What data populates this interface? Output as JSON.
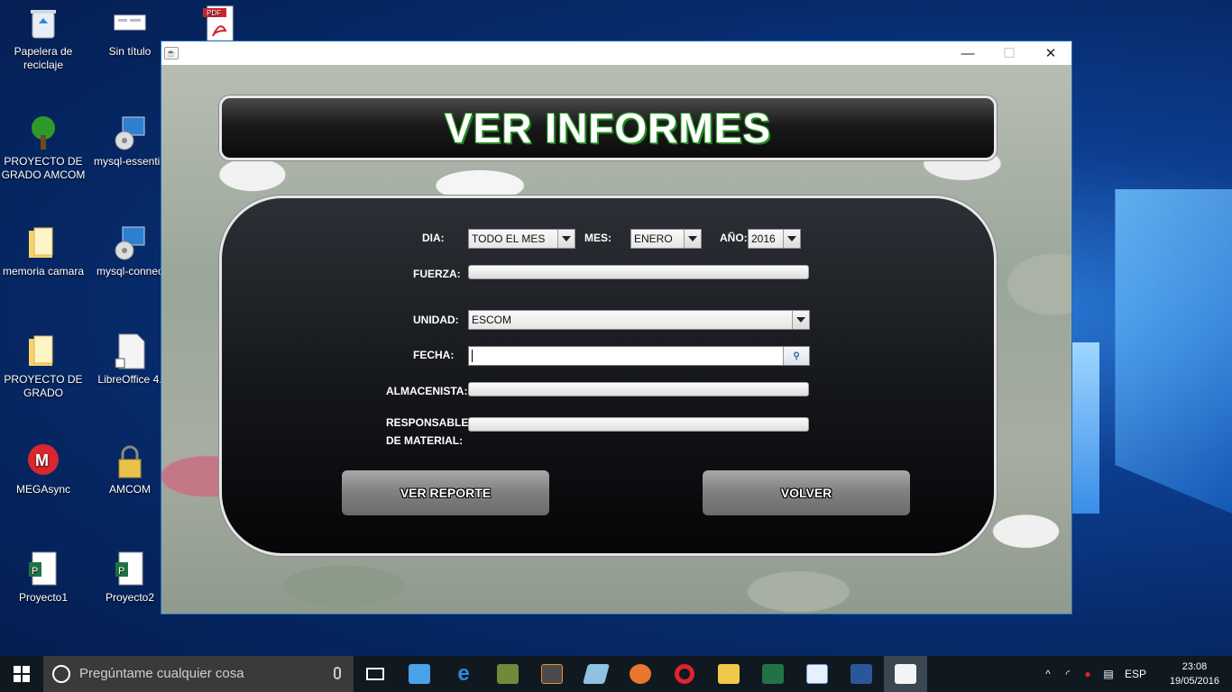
{
  "desktop": {
    "icons": [
      {
        "label": "Papelera de reciclaje",
        "icon": "recycle-bin-icon"
      },
      {
        "label": "Sin título",
        "icon": "image-file-icon"
      },
      {
        "label": "PDF",
        "icon": "pdf-icon"
      },
      {
        "label": "PROYECTO DE GRADO AMCOM",
        "icon": "tree-icon"
      },
      {
        "label": "mysql-essentia",
        "icon": "installer-icon"
      },
      {
        "label": "memoria camara",
        "icon": "folder-icon"
      },
      {
        "label": "mysql-connec",
        "icon": "installer-icon"
      },
      {
        "label": "PROYECTO DE GRADO",
        "icon": "folder-icon"
      },
      {
        "label": "LibreOffice 4.",
        "icon": "document-icon"
      },
      {
        "label": "MEGAsync",
        "icon": "mega-icon"
      },
      {
        "label": "AMCOM",
        "icon": "lock-icon"
      },
      {
        "label": "Proyecto1",
        "icon": "project-icon"
      },
      {
        "label": "Proyecto2",
        "icon": "project-icon"
      }
    ]
  },
  "window": {
    "app_icon": "java-icon",
    "minimize": "—",
    "maximize": "☐",
    "close": "✕"
  },
  "header": {
    "title": "VER INFORMES"
  },
  "form": {
    "dia_label": "DIA:",
    "dia_value": "TODO EL MES",
    "mes_label": "MES:",
    "mes_value": "ENERO",
    "anio_label": "AÑO:",
    "anio_value": "2016",
    "fuerza_label": "FUERZA:",
    "unidad_label": "UNIDAD:",
    "unidad_value": "ESCOM",
    "fecha_label": "FECHA:",
    "fecha_value": "",
    "almacenista_label": "ALMACENISTA:",
    "responsable_label_1": "RESPONSABLE",
    "responsable_label_2": "DE MATERIAL:",
    "ver_reporte": "VER REPORTE",
    "volver": "VOLVER"
  },
  "taskbar": {
    "search_placeholder": "Pregúntame cualquier cosa",
    "language": "ESP",
    "time": "23:08",
    "date": "19/05/2016",
    "colors": {
      "bg": "#101820",
      "search_bg": "#3a3a3a"
    }
  }
}
